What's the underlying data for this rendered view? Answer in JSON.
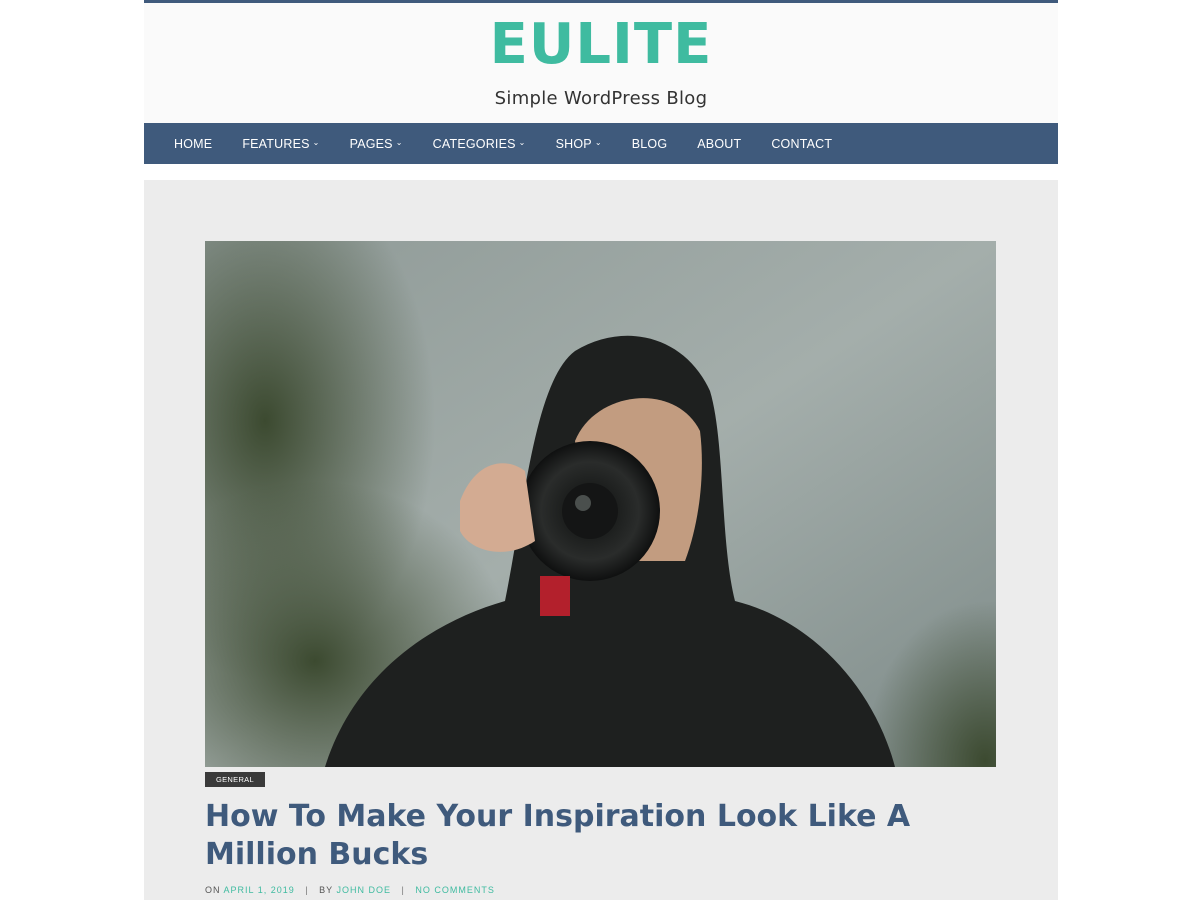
{
  "site": {
    "title": "EULITE",
    "tagline": "Simple WordPress Blog"
  },
  "colors": {
    "accent": "#3fbba0",
    "nav_background": "#3f5a7c",
    "content_background": "#ececec",
    "badge_background": "#3a3a3a"
  },
  "nav": {
    "items": [
      {
        "label": "HOME",
        "has_dropdown": false
      },
      {
        "label": "FEATURES",
        "has_dropdown": true
      },
      {
        "label": "PAGES",
        "has_dropdown": true
      },
      {
        "label": "CATEGORIES",
        "has_dropdown": true
      },
      {
        "label": "SHOP",
        "has_dropdown": true
      },
      {
        "label": "BLOG",
        "has_dropdown": false
      },
      {
        "label": "ABOUT",
        "has_dropdown": false
      },
      {
        "label": "CONTACT",
        "has_dropdown": false
      }
    ],
    "dropdown_icon": "chevron-down-icon"
  },
  "post": {
    "category": "GENERAL",
    "title": "How To Make Your Inspiration Look Like A Million Bucks",
    "meta": {
      "on_label": "ON",
      "date": "APRIL 1, 2019",
      "separator": "|",
      "by_label": "BY",
      "author": "JOHN DOE",
      "comments": "NO COMMENTS"
    }
  }
}
